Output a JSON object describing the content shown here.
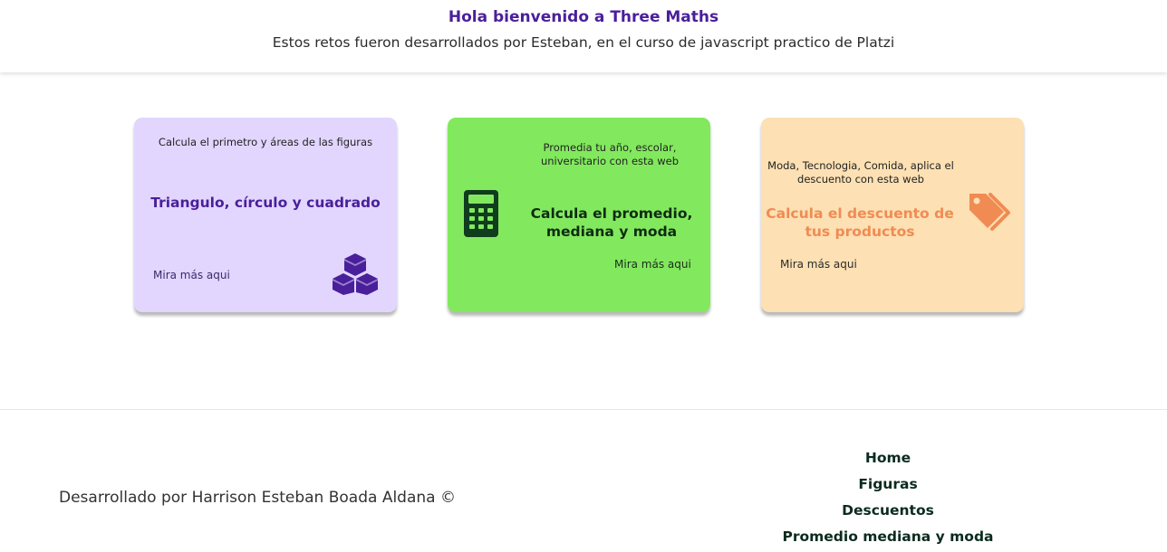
{
  "header": {
    "title": "Hola bienvenido a Three Maths",
    "subtitle": "Estos retos fueron desarrollados por Esteban, en el curso de javascript practico de Platzi"
  },
  "cards": [
    {
      "description": "Calcula el primetro y áreas de las figuras",
      "title": "Triangulo, círculo y cuadrado",
      "link": "Mira más aqui",
      "icon": "cubes-icon",
      "colors": {
        "background": "#e2d6ff",
        "title": "#4a1f9a",
        "icon": "#4a1f9a"
      }
    },
    {
      "description": "Promedia tu año, escolar, universitario con esta web",
      "title": "Calcula el promedio, mediana y moda",
      "link": "Mira más aqui",
      "icon": "calculator-icon",
      "colors": {
        "background": "#82e95e",
        "title": "#0f2b12",
        "icon": "#0f3d1e"
      }
    },
    {
      "description": "Moda, Tecnologia, Comida, aplica el descuento con esta web",
      "title": "Calcula el descuento de tus productos",
      "link": "Mira más aqui",
      "icon": "tags-icon",
      "colors": {
        "background": "#fde0b3",
        "title": "#f08b53",
        "icon": "#f08b53"
      }
    }
  ],
  "footer": {
    "credit": "Desarrollado por Harrison Esteban Boada Aldana ©",
    "nav": [
      "Home",
      "Figuras",
      "Descuentos",
      "Promedio mediana y moda"
    ]
  }
}
